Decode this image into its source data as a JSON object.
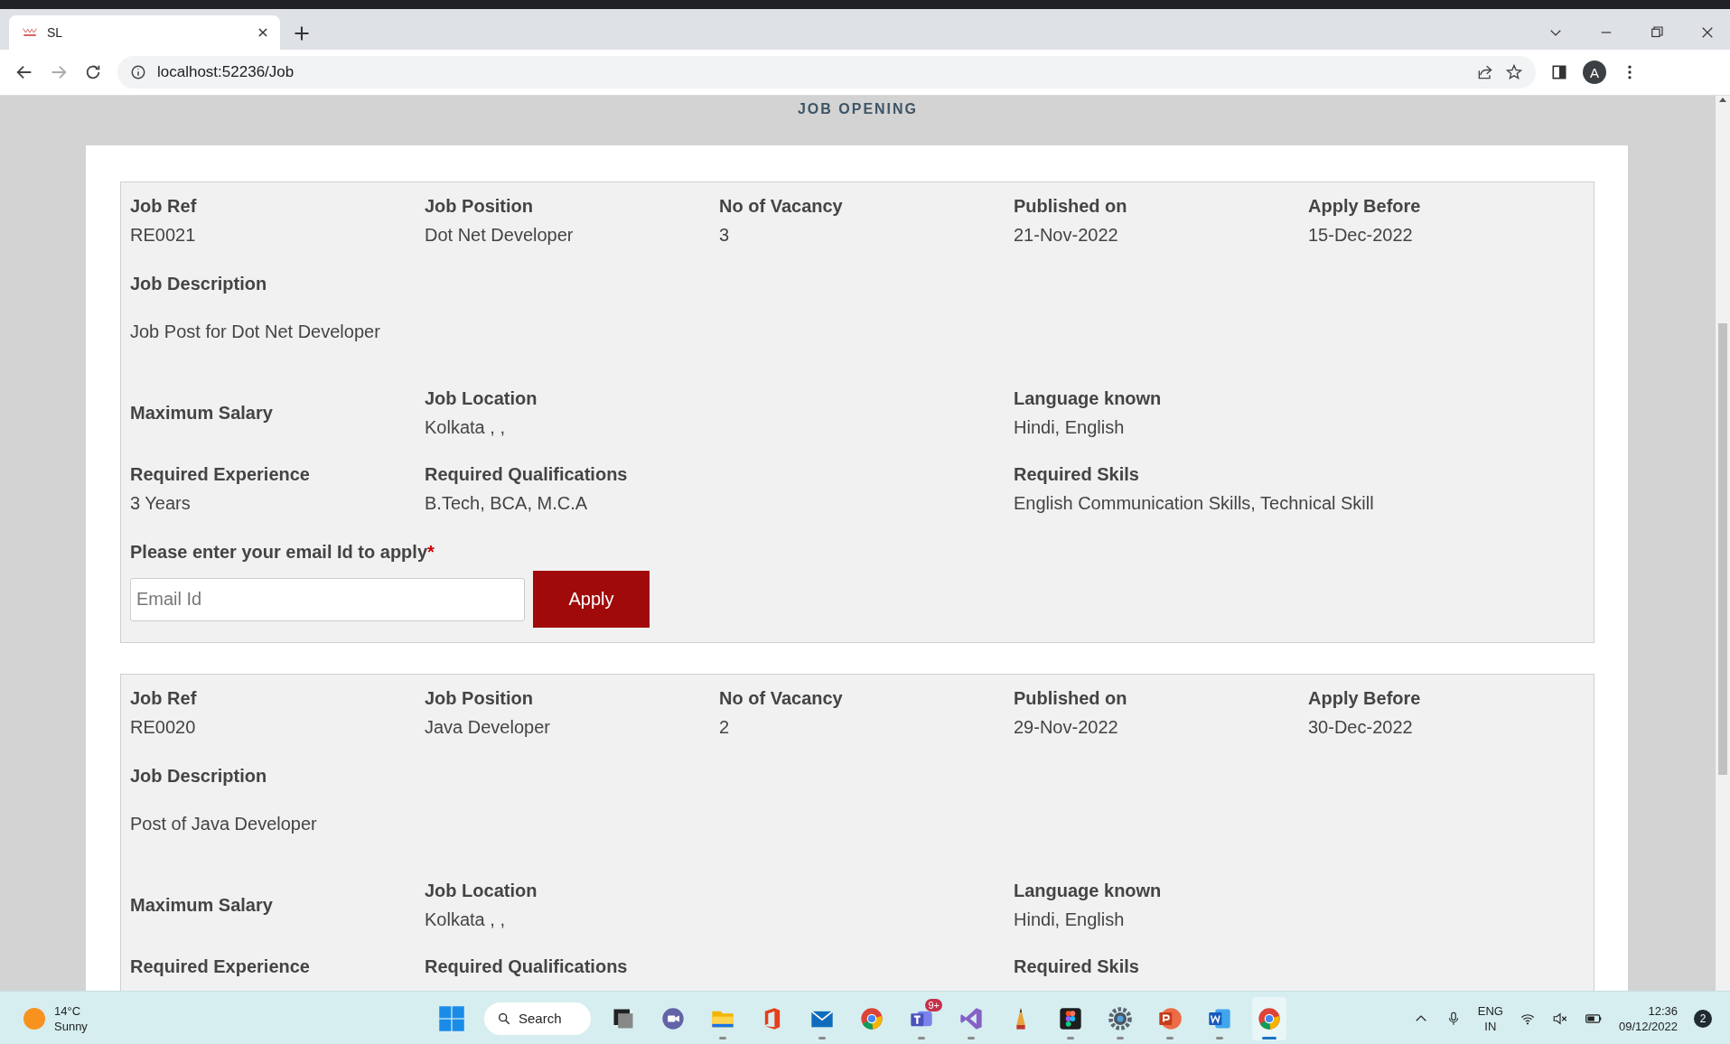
{
  "browser": {
    "tab_title": "SL",
    "url": "localhost:52236/Job",
    "profile_initial": "A"
  },
  "page": {
    "heading": "JOB OPENING",
    "jobs": [
      {
        "summary": [
          {
            "label": "Job Ref",
            "value": "RE0021"
          },
          {
            "label": "Job Position",
            "value": "Dot Net Developer"
          },
          {
            "label": "No of Vacancy",
            "value": "3"
          },
          {
            "label": "Published on",
            "value": "21-Nov-2022"
          },
          {
            "label": "Apply Before",
            "value": "15-Dec-2022"
          }
        ],
        "description": {
          "label": "Job Description",
          "text": "Job Post for Dot Net Developer"
        },
        "details": [
          [
            {
              "label": "Maximum Salary"
            },
            {
              "label": "Job Location",
              "value": "Kolkata , ,"
            },
            {
              "label": "Language known",
              "value": "Hindi, English"
            }
          ],
          [
            {
              "label": "Required Experience",
              "value": "3 Years"
            },
            {
              "label": "Required Qualifications",
              "value": "B.Tech, BCA, M.C.A"
            },
            {
              "label": "Required Skils",
              "value": "English Communication Skills, Technical Skill"
            }
          ]
        ],
        "apply": {
          "prompt": "Please enter your email Id to apply",
          "required_mark": "*",
          "placeholder": "Email Id",
          "button": "Apply"
        }
      },
      {
        "summary": [
          {
            "label": "Job Ref",
            "value": "RE0020"
          },
          {
            "label": "Job Position",
            "value": "Java Developer"
          },
          {
            "label": "No of Vacancy",
            "value": "2"
          },
          {
            "label": "Published on",
            "value": "29-Nov-2022"
          },
          {
            "label": "Apply Before",
            "value": "30-Dec-2022"
          }
        ],
        "description": {
          "label": "Job Description",
          "text": "Post of Java Developer"
        },
        "details": [
          [
            {
              "label": "Maximum Salary"
            },
            {
              "label": "Job Location",
              "value": "Kolkata , ,"
            },
            {
              "label": "Language known",
              "value": "Hindi, English"
            }
          ],
          [
            {
              "label": "Required Experience"
            },
            {
              "label": "Required Qualifications"
            },
            {
              "label": "Required Skils"
            }
          ]
        ]
      }
    ]
  },
  "taskbar": {
    "weather": {
      "temperature": "14°C",
      "condition": "Sunny"
    },
    "search": "Search",
    "apps": [
      {
        "running": false,
        "active": false
      },
      {
        "running": false,
        "active": false
      },
      {
        "running": false,
        "active": false
      },
      {
        "running": true,
        "active": false
      },
      {
        "running": false,
        "active": false
      },
      {
        "running": true,
        "active": false
      },
      {
        "running": false,
        "active": false
      },
      {
        "running": true,
        "active": false,
        "badge": "9+"
      },
      {
        "running": true,
        "active": false
      },
      {
        "running": false,
        "active": false
      },
      {
        "running": true,
        "active": false
      },
      {
        "running": true,
        "active": false
      },
      {
        "running": true,
        "active": false
      },
      {
        "running": true,
        "active": false
      },
      {
        "running": true,
        "active": true
      }
    ],
    "language": "ENG",
    "region": "IN",
    "time": "12:36",
    "date": "09/12/2022",
    "notifications": "2"
  }
}
